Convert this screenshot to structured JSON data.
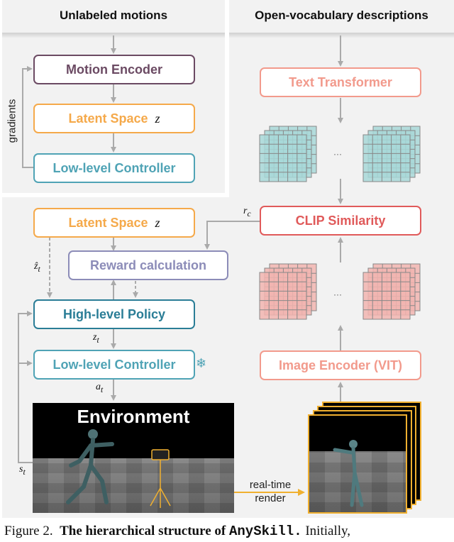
{
  "headers": {
    "left": "Unlabeled motions",
    "right": "Open-vocabulary descriptions"
  },
  "top_left": {
    "motion_encoder": "Motion Encoder",
    "latent_space": "Latent Space",
    "latent_symbol": "z",
    "low_level_controller": "Low-level Controller",
    "gradients_label": "gradients"
  },
  "bottom_left": {
    "latent_space": "Latent Space",
    "latent_symbol": "z",
    "reward_calculation": "Reward calculation",
    "high_level_policy": "High-level Policy",
    "low_level_controller": "Low-level Controller",
    "frozen_icon": "snowflake-icon",
    "z_hat_label": "ẑ",
    "z_hat_sub": "t",
    "z_t_label": "z",
    "z_t_sub": "t",
    "a_t_label": "a",
    "a_t_sub": "t",
    "s_t_label": "s",
    "s_t_sub": "t",
    "environment_title": "Environment"
  },
  "right": {
    "text_transformer": "Text Transformer",
    "clip_similarity": "CLIP Similarity",
    "image_encoder": "Image Encoder (VIT)",
    "ellipsis": "···",
    "r_c_label": "r",
    "r_c_sub": "c",
    "render_label_line1": "real-time",
    "render_label_line2": "render"
  },
  "colors": {
    "motion_encoder": "#6b4a63",
    "latent": "#f5a94a",
    "low_level": "#4fa3b5",
    "high_level": "#2a7d96",
    "reward": "#8c8cb8",
    "text_transformer": "#f29a8c",
    "clip": "#e05a5a",
    "image_encoder": "#f29a8c",
    "teal_grid": "#a8d8d8",
    "red_grid": "#f2b5b0",
    "render_arrow": "#f0b030",
    "wire": "#aaaaaa"
  },
  "caption": {
    "prefix": "Figure 2.",
    "bold": "The hierarchical structure of",
    "code": "AnySkill.",
    "rest": "Initially,"
  }
}
